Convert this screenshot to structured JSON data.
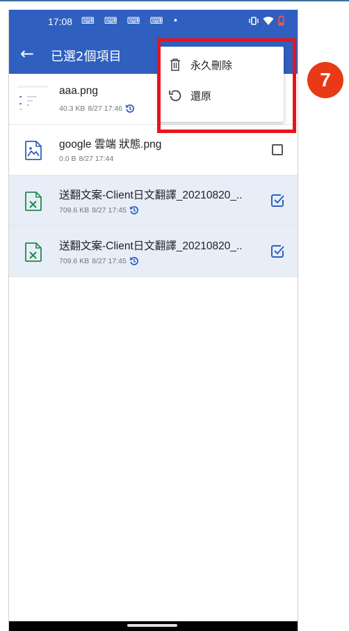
{
  "status_bar": {
    "time": "17:08",
    "notifications": "⌨ ⌨ ⌨ ⌨ •"
  },
  "app_bar": {
    "back_glyph": "←",
    "title": "已選2個項目"
  },
  "menu": {
    "items": [
      {
        "label": "永久刪除",
        "icon": "trash-icon"
      },
      {
        "label": "還原",
        "icon": "restore-icon"
      }
    ]
  },
  "files": [
    {
      "name": "aaa.png",
      "size": "40.3 KB",
      "date": "8/27 17:46",
      "history": true,
      "selected": false,
      "type": "image-thumbnail"
    },
    {
      "name": "google 雲端 狀態.png",
      "size": "0.0 B",
      "date": "8/27 17:44",
      "history": false,
      "selected": false,
      "type": "image"
    },
    {
      "name": "送翻文案-Client日文翻譯_20210820_..",
      "size": "709.6 KB",
      "date": "8/27 17:45",
      "history": true,
      "selected": true,
      "type": "excel"
    },
    {
      "name": "送翻文案-Client日文翻譯_20210820_..",
      "size": "709.6 KB",
      "date": "8/27 17:45",
      "history": true,
      "selected": true,
      "type": "excel"
    }
  ],
  "annotation": {
    "badge": "7"
  },
  "colors": {
    "primary": "#2f5fbf",
    "selected_row": "#e8eef8",
    "excel_green": "#1e8a4a",
    "highlight_red": "#e8141c"
  }
}
